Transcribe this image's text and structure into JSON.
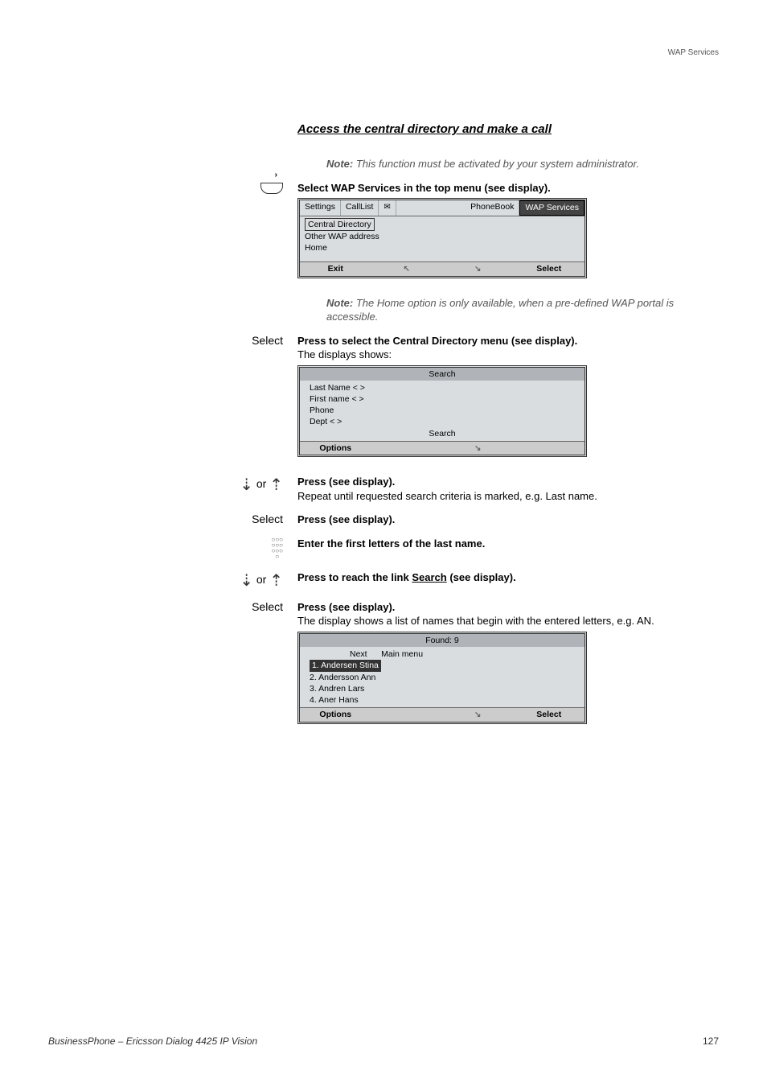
{
  "header": {
    "section": "WAP Services"
  },
  "section_title": "Access the central directory and make a call",
  "note1": {
    "label": "Note:",
    "text": "This function must be activated by your system administrator."
  },
  "step1": {
    "bold": "Select WAP Services in the top menu (see display)."
  },
  "display1": {
    "tabs": {
      "t1": "Settings",
      "t2": "CallList",
      "t3": "PhoneBook",
      "t4": "WAP Services"
    },
    "items": {
      "i1": "Central Directory",
      "i2": "Other WAP address",
      "i3": "Home"
    },
    "bottom": {
      "b1": "Exit",
      "b4": "Select"
    }
  },
  "note2": {
    "label": "Note:",
    "text": "The Home option is only available, when a pre-defined WAP portal is accessible."
  },
  "step2": {
    "left": "Select",
    "bold": "Press to select the Central Directory menu (see display).",
    "plain": "The displays shows:"
  },
  "display2": {
    "title": "Search",
    "rows": {
      "r1": "Last Name  < >",
      "r2": "First name  < >",
      "r3": "Phone",
      "r4": "Dept  < >",
      "r5": "Search"
    },
    "bottom": {
      "b1": "Options"
    }
  },
  "step3": {
    "left_or": "or",
    "bold": "Press (see display).",
    "plain": "Repeat until requested search criteria is marked, e.g. Last name."
  },
  "step4": {
    "left": "Select",
    "bold": "Press (see display)."
  },
  "step5": {
    "bold": "Enter the first letters of the last name."
  },
  "step6": {
    "left_or": "or",
    "bold_pre": "Press to reach the link ",
    "bold_link": "Search",
    "bold_post": " (see display)."
  },
  "step7": {
    "left": "Select",
    "bold": "Press (see display).",
    "plain": "The display shows a list of names that begin with the entered letters, e.g. AN."
  },
  "display3": {
    "title": "Found: 9",
    "top": {
      "t1": "Next",
      "t2": "Main menu"
    },
    "rows": {
      "r1": "1. Andersen Stina",
      "r2": "2. Andersson Ann",
      "r3": "3. Andren Lars",
      "r4": "4. Aner Hans"
    },
    "bottom": {
      "b1": "Options",
      "b4": "Select"
    }
  },
  "footer": {
    "product": "BusinessPhone – Ericsson Dialog 4425 IP Vision",
    "page": "127"
  }
}
